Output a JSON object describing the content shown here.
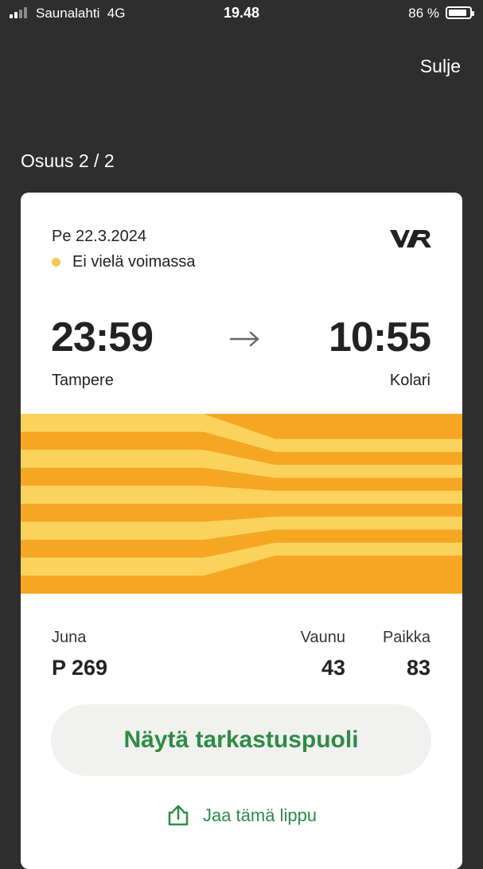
{
  "status_bar": {
    "carrier": "Saunalahti",
    "network": "4G",
    "time": "19.48",
    "battery_percent": "86 %",
    "battery_level": 0.86,
    "signal_bars_active": 2,
    "signal_bars_total": 4
  },
  "header": {
    "close_label": "Sulje",
    "leg_label": "Osuus 2 / 2"
  },
  "ticket": {
    "date": "Pe 22.3.2024",
    "validity_status": "Ei vielä voimassa",
    "validity_color": "#f2c94c",
    "logo": "VR",
    "departure_time": "23:59",
    "departure_station": "Tampere",
    "arrival_time": "10:55",
    "arrival_station": "Kolari",
    "pattern_colors": {
      "light": "#fbd35c",
      "dark": "#f5a623"
    },
    "train_label": "Juna",
    "train_value": "P 269",
    "car_label": "Vaunu",
    "car_value": "43",
    "seat_label": "Paikka",
    "seat_value": "83"
  },
  "actions": {
    "inspect_button": "Näytä tarkastuspuoli",
    "share_link": "Jaa tämä lippu",
    "accent_color": "#2e8b46"
  }
}
